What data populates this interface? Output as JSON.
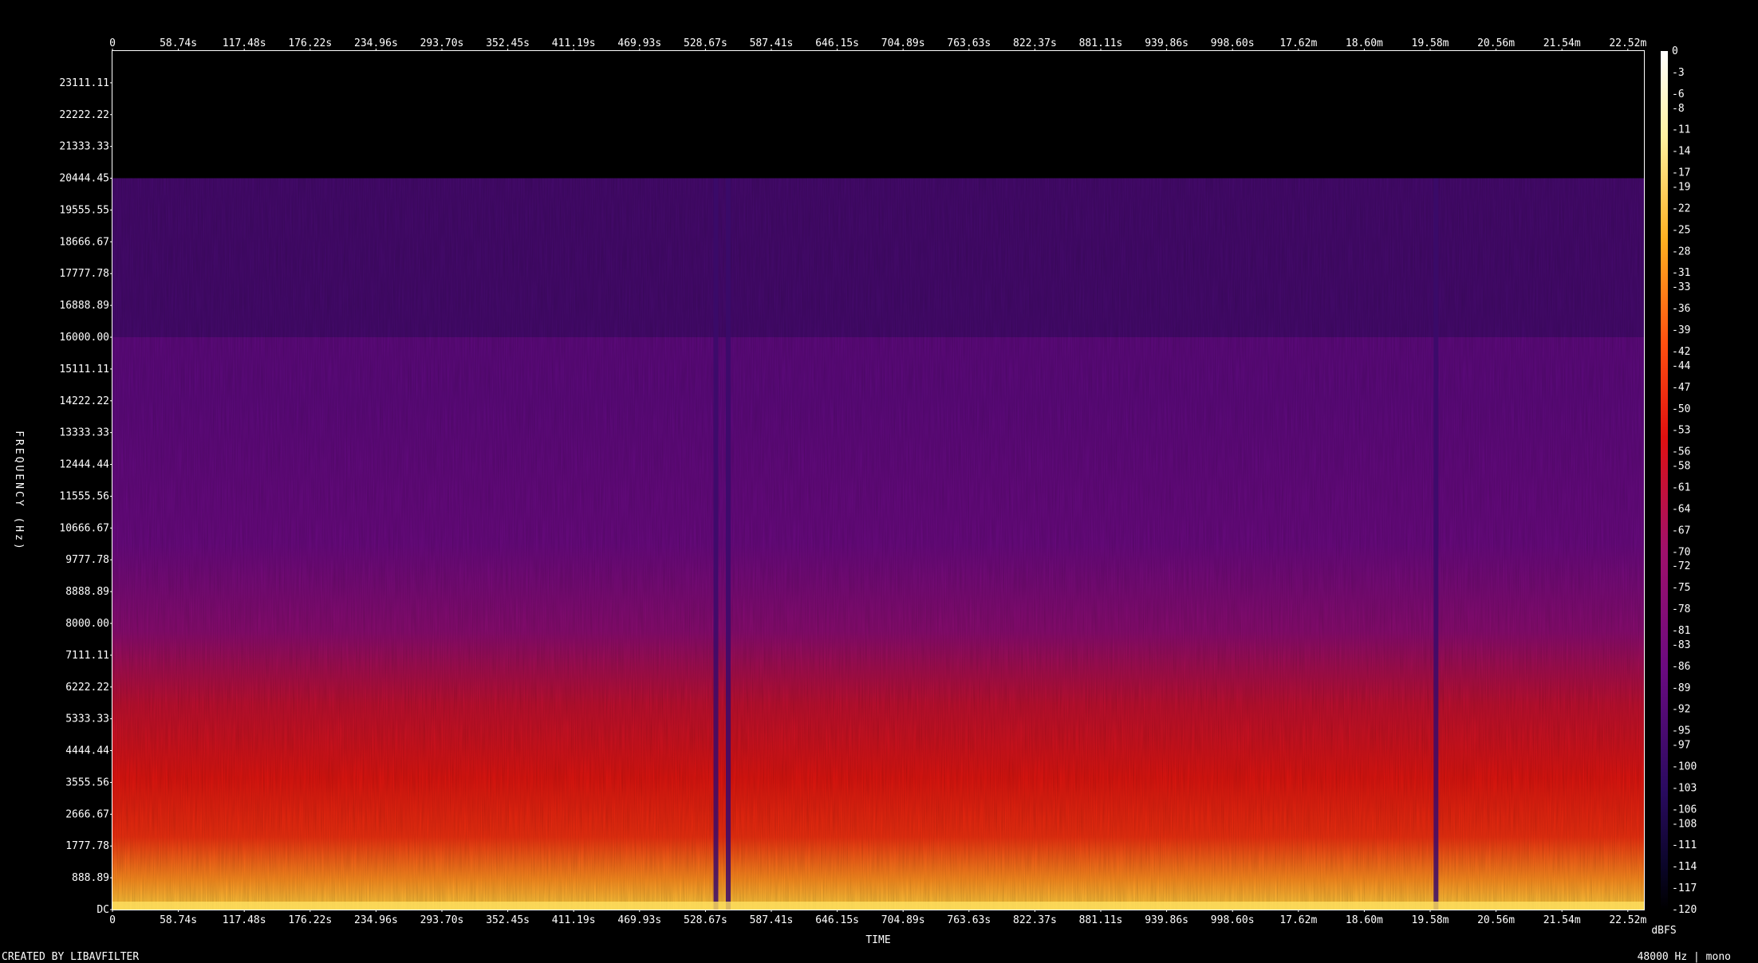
{
  "chart_data": {
    "type": "heatmap",
    "title": "",
    "xlabel": "TIME",
    "ylabel": "FREQUENCY (Hz)",
    "x_ticks": [
      "0",
      "58.74s",
      "117.48s",
      "176.22s",
      "234.96s",
      "293.70s",
      "352.45s",
      "411.19s",
      "469.93s",
      "528.67s",
      "587.41s",
      "646.15s",
      "704.89s",
      "763.63s",
      "822.37s",
      "881.11s",
      "939.86s",
      "998.60s",
      "17.62m",
      "18.60m",
      "19.58m",
      "20.56m",
      "21.54m",
      "22.52m"
    ],
    "y_ticks": [
      "DC",
      "888.89",
      "1777.78",
      "2666.67",
      "3555.56",
      "4444.44",
      "5333.33",
      "6222.22",
      "7111.11",
      "8000.00",
      "8888.89",
      "9777.78",
      "10666.67",
      "11555.56",
      "12444.44",
      "13333.33",
      "14222.22",
      "15111.11",
      "16000.00",
      "16888.89",
      "17777.78",
      "18666.67",
      "19555.55",
      "20444.45",
      "21333.33",
      "22222.22",
      "23111.11"
    ],
    "ylim": [
      0,
      24000
    ],
    "colorbar_label": "dBFS",
    "colorbar_ticks": [
      "0",
      "-3",
      "-6",
      "-8",
      "-11",
      "-14",
      "-17",
      "-19",
      "-22",
      "-25",
      "-28",
      "-31",
      "-33",
      "-36",
      "-39",
      "-42",
      "-44",
      "-47",
      "-50",
      "-53",
      "-56",
      "-58",
      "-61",
      "-64",
      "-67",
      "-70",
      "-72",
      "-75",
      "-78",
      "-81",
      "-83",
      "-86",
      "-89",
      "-92",
      "-95",
      "-97",
      "-100",
      "-103",
      "-106",
      "-108",
      "-111",
      "-114",
      "-117",
      "-120"
    ],
    "colorbar_range": [
      0,
      -120
    ],
    "lowpass_cutoff_hz": 20444.45,
    "secondary_band_hz": 16000,
    "silence_gaps_s": [
      538,
      549,
      1180
    ],
    "colormap": [
      "#000000",
      "#1a0a4a",
      "#3a0a78",
      "#6a0a80",
      "#9a1060",
      "#d0102a",
      "#f01810",
      "#ff5010",
      "#ffa020",
      "#ffe060",
      "#ffffff"
    ]
  },
  "footer": {
    "left": "CREATED BY LIBAVFILTER",
    "right": "48000 Hz | mono"
  }
}
